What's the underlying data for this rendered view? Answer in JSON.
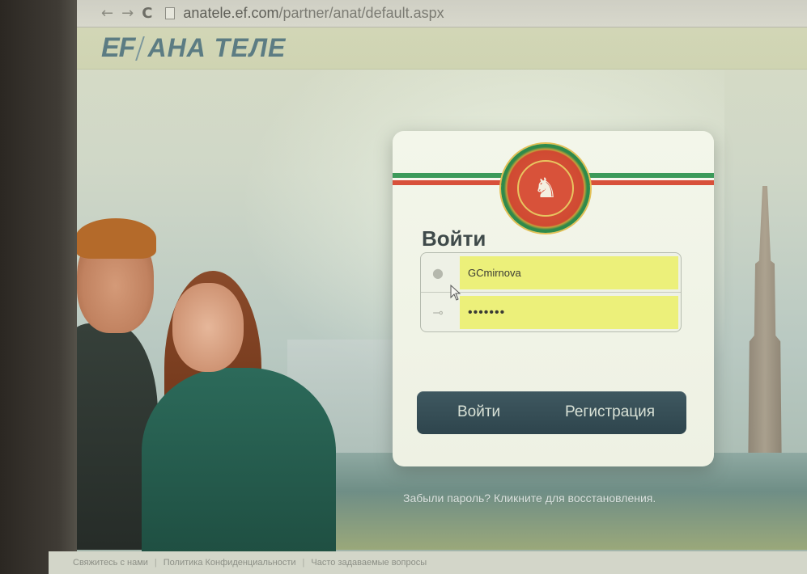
{
  "browser": {
    "url_prefix": "anatele.ef.com",
    "url_path": "/partner/anat/default.aspx"
  },
  "brand": {
    "logo": "EF",
    "title": "АНА ТЕЛЕ"
  },
  "login": {
    "title": "Войти",
    "username_value": "GCmirnova",
    "password_value": "•••••••",
    "login_button": "Войти",
    "register_button": "Регистрация",
    "forgot_link": "Забыли пароль? Кликните для восстановления."
  },
  "footer": {
    "links": [
      "Свяжитесь с нами",
      "Политика Конфиденциальности",
      "Часто задаваемые вопросы"
    ]
  },
  "icons": {
    "user_icon": "user-icon",
    "key_icon": "key-icon",
    "emblem": "tatarstan-emblem-icon"
  },
  "colors": {
    "input_highlight": "#ecf07a",
    "button_bar": "#3f5860",
    "flag_green": "#3c9a5a",
    "flag_red": "#d8503a",
    "brand_text": "#5c7c83"
  }
}
